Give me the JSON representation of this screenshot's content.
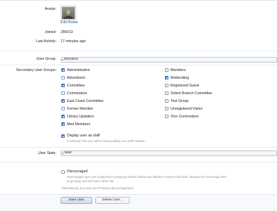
{
  "avatar": {
    "label": "Avatar:",
    "edit_link": "Edit Avatar"
  },
  "joined": {
    "label": "Joined:",
    "value": "28/5/13"
  },
  "last_activity": {
    "label": "Last Activity:",
    "value": "17 minutes ago"
  },
  "user_group": {
    "label": "User Group:",
    "value": "Members"
  },
  "secondary_groups": {
    "label": "Secondary User Groups:",
    "left": [
      {
        "name": "Administrative",
        "checked": true
      },
      {
        "name": "Advertisers",
        "checked": false
      },
      {
        "name": "Committee",
        "checked": true
      },
      {
        "name": "Commodore",
        "checked": false
      },
      {
        "name": "East Coast Committee",
        "checked": true
      },
      {
        "name": "Former Member",
        "checked": false
      },
      {
        "name": "Library Updaters",
        "checked": true
      },
      {
        "name": "Med Members",
        "checked": true
      }
    ],
    "right": [
      {
        "name": "Members",
        "checked": false
      },
      {
        "name": "Moderating",
        "checked": true
      },
      {
        "name": "Registered Guest",
        "checked": false
      },
      {
        "name": "Solent Branch Committee",
        "checked": false
      },
      {
        "name": "Test Group",
        "checked": false
      },
      {
        "name": "Unregistered Visitor",
        "checked": false
      },
      {
        "name": "Vice Commodore",
        "checked": false
      }
    ]
  },
  "display_staff": {
    "label": "Display user as staff",
    "checked": true,
    "hint": "If selected, this user will be listed publicly as a staff member."
  },
  "user_state": {
    "label": "User State:",
    "value": "Valid"
  },
  "discouraged": {
    "label": "Discouraged",
    "checked": false,
    "hint_line1": "Discouraged users are subjected to annoying random delays and failures in system behavior, designed to encourage them",
    "hint_line2": "to go away and troll some other site.",
    "alt_text": "Alternatively, you may use IP-based discouragement."
  },
  "buttons": {
    "save": "Save User",
    "delete": "Delete User..."
  }
}
